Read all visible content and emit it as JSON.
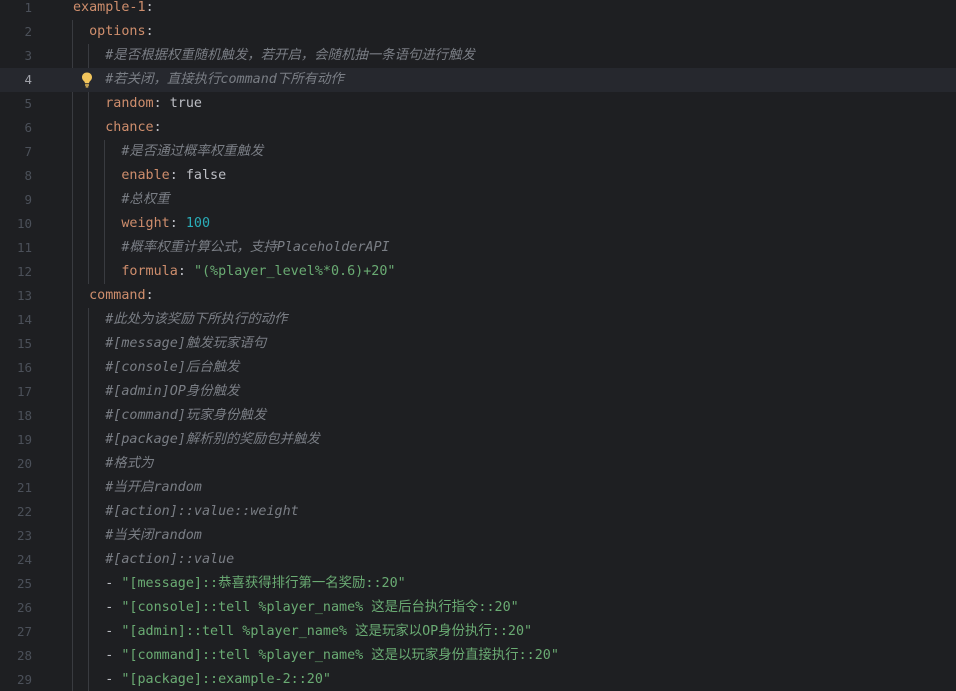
{
  "editor": {
    "language": "yaml",
    "current_line": 4,
    "colors": {
      "background": "#1e1f22",
      "current_line": "#26282e",
      "key": "#cf8e6d",
      "string": "#6aab73",
      "number": "#2aacb8",
      "comment": "#7a7e85",
      "text": "#bcbec4",
      "line_number": "#4b5059",
      "indent_guide": "#393b40",
      "bulb": "#f2c55c"
    },
    "lines": [
      {
        "num": "1",
        "indent": "",
        "kind": "key",
        "key": "example-1",
        "sep": ":",
        "value": ""
      },
      {
        "num": "2",
        "indent": "  ",
        "kind": "key",
        "key": "options",
        "sep": ":",
        "value": ""
      },
      {
        "num": "3",
        "indent": "    ",
        "kind": "comment",
        "text": "#是否根据权重随机触发，若开启，会随机抽一条语句进行触发"
      },
      {
        "num": "4",
        "indent": "    ",
        "kind": "comment",
        "text": "#若关闭，直接执行command下所有动作"
      },
      {
        "num": "5",
        "indent": "    ",
        "kind": "key",
        "key": "random",
        "sep": ": ",
        "value": "true",
        "vtype": "val"
      },
      {
        "num": "6",
        "indent": "    ",
        "kind": "key",
        "key": "chance",
        "sep": ":",
        "value": ""
      },
      {
        "num": "7",
        "indent": "      ",
        "kind": "comment",
        "text": "#是否通过概率权重触发"
      },
      {
        "num": "8",
        "indent": "      ",
        "kind": "key",
        "key": "enable",
        "sep": ": ",
        "value": "false",
        "vtype": "val"
      },
      {
        "num": "9",
        "indent": "      ",
        "kind": "comment",
        "text": "#总权重"
      },
      {
        "num": "10",
        "indent": "      ",
        "kind": "key",
        "key": "weight",
        "sep": ": ",
        "value": "100",
        "vtype": "num"
      },
      {
        "num": "11",
        "indent": "      ",
        "kind": "comment",
        "text": "#概率权重计算公式，支持PlaceholderAPI"
      },
      {
        "num": "12",
        "indent": "      ",
        "kind": "key",
        "key": "formula",
        "sep": ": ",
        "value": "\"(%player_level%*0.6)+20\"",
        "vtype": "str"
      },
      {
        "num": "13",
        "indent": "  ",
        "kind": "key",
        "key": "command",
        "sep": ":",
        "value": ""
      },
      {
        "num": "14",
        "indent": "    ",
        "kind": "comment",
        "text": "#此处为该奖励下所执行的动作"
      },
      {
        "num": "15",
        "indent": "    ",
        "kind": "comment",
        "text": "#[message]触发玩家语句"
      },
      {
        "num": "16",
        "indent": "    ",
        "kind": "comment",
        "text": "#[console]后台触发"
      },
      {
        "num": "17",
        "indent": "    ",
        "kind": "comment",
        "text": "#[admin]OP身份触发"
      },
      {
        "num": "18",
        "indent": "    ",
        "kind": "comment",
        "text": "#[command]玩家身份触发"
      },
      {
        "num": "19",
        "indent": "    ",
        "kind": "comment",
        "text": "#[package]解析别的奖励包并触发"
      },
      {
        "num": "20",
        "indent": "    ",
        "kind": "comment",
        "text": "#格式为"
      },
      {
        "num": "21",
        "indent": "    ",
        "kind": "comment",
        "text": "#当开启random"
      },
      {
        "num": "22",
        "indent": "    ",
        "kind": "comment",
        "text": "#[action]::value::weight"
      },
      {
        "num": "23",
        "indent": "    ",
        "kind": "comment",
        "text": "#当关闭random"
      },
      {
        "num": "24",
        "indent": "    ",
        "kind": "comment",
        "text": "#[action]::value"
      },
      {
        "num": "25",
        "indent": "    ",
        "kind": "item",
        "dash": "- ",
        "value": "\"[message]::恭喜获得排行第一名奖励::20\""
      },
      {
        "num": "26",
        "indent": "    ",
        "kind": "item",
        "dash": "- ",
        "value": "\"[console]::tell %player_name% 这是后台执行指令::20\""
      },
      {
        "num": "27",
        "indent": "    ",
        "kind": "item",
        "dash": "- ",
        "value": "\"[admin]::tell %player_name% 这是玩家以OP身份执行::20\""
      },
      {
        "num": "28",
        "indent": "    ",
        "kind": "item",
        "dash": "- ",
        "value": "\"[command]::tell %player_name% 这是以玩家身份直接执行::20\""
      },
      {
        "num": "29",
        "indent": "    ",
        "kind": "item",
        "dash": "- ",
        "value": "\"[package]::example-2::20\""
      }
    ]
  },
  "icons": {
    "bulb": "lightbulb-icon"
  }
}
